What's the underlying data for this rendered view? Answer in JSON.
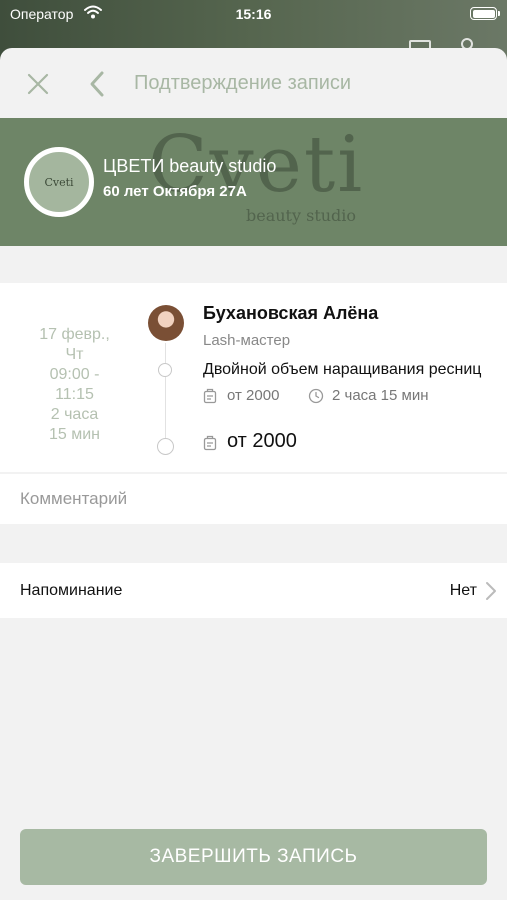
{
  "status_bar": {
    "carrier": "Оператор",
    "time": "15:16"
  },
  "header": {
    "title": "Подтверждение записи"
  },
  "studio": {
    "name": "ЦВЕТИ beauty studio",
    "address": "60 лет Октября 27А",
    "logo_text": "Cveti",
    "watermark_text": "Cveti",
    "watermark_subtext": "beauty studio",
    "banner_color": "#6e8567"
  },
  "booking": {
    "date": "17 февр.,\nЧт\n09:00 -\n11:15\n2 часа\n15 мин",
    "master_name": "Бухановская Алёна",
    "master_role": "Lash-мастер",
    "service_name": "Двойной объем наращивания ресниц",
    "service_price": "от 2000",
    "service_duration": "2 часа 15 мин",
    "total_price": "от 2000"
  },
  "comment": {
    "placeholder": "Комментарий"
  },
  "reminder": {
    "label": "Напоминание",
    "value": "Нет"
  },
  "actions": {
    "finish_label": "Завершить запись"
  },
  "colors": {
    "accent": "#a7b9a3",
    "header_text": "#a8b7a4"
  }
}
